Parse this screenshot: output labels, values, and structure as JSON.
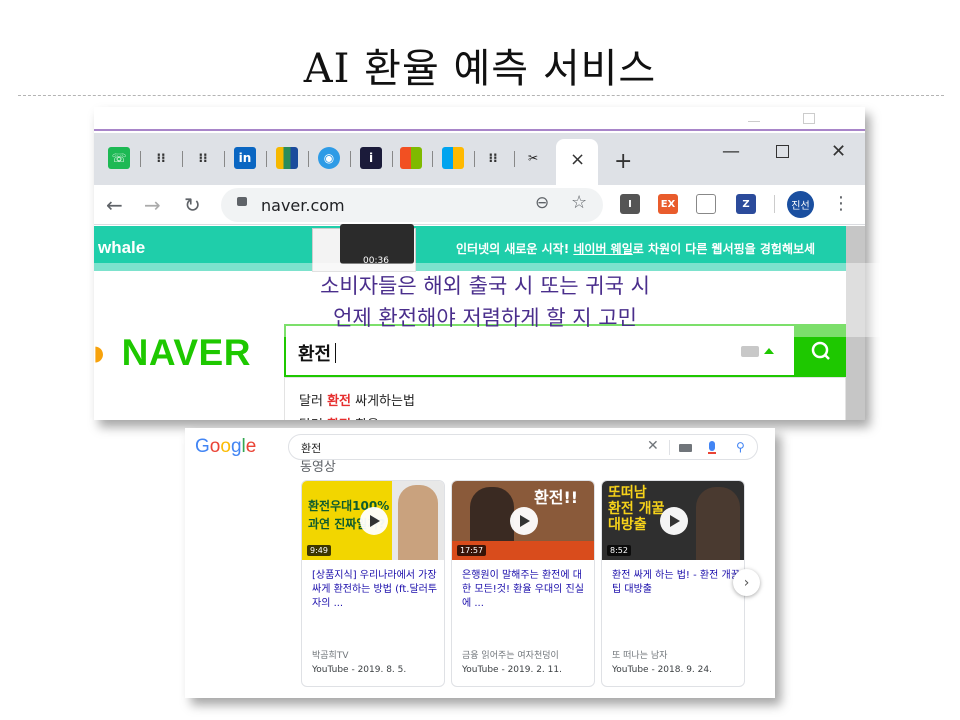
{
  "slide": {
    "title": "AI 환율 예측 서비스"
  },
  "browser": {
    "new_tab_label": "+",
    "close_tab_label": "×",
    "url": "naver.com",
    "extensions": [
      "I",
      "EX",
      "Z"
    ],
    "profile": "진선",
    "whale_banner": {
      "logo": "whale",
      "message_prefix": "인터넷의 새로운 시작! ",
      "message_link": "네이버 웨일",
      "message_suffix": "로 차원이 다른 웹서핑을 경험해보세",
      "video_time": "00:36"
    },
    "naver": {
      "logo": "NAVER",
      "query": "환전",
      "suggestions": [
        {
          "before": "달러 ",
          "hit": "환전",
          "after": " 싸게하는법"
        },
        {
          "before": "달러 ",
          "hit": "환전",
          "after": " 환율"
        }
      ]
    }
  },
  "overlay": {
    "line1": "소비자들은 해외 출국  시 또는 귀국 시",
    "line2": "언제 환전해야 저렴하게 할 지 고민"
  },
  "google": {
    "logo": "Google",
    "query": "환전",
    "section_clip": "동영상",
    "videos": [
      {
        "thumb_text": "환전우대100%\n과연 진짜일까?",
        "duration": "9:49",
        "title": "[상품지식] 우리나라에서 가장 싸게 환전하는 방법 (ft.달러투자의 ...",
        "channel": "박곰희TV",
        "meta": "YouTube - 2019. 8. 5."
      },
      {
        "thumb_text": "환전!!",
        "duration": "17:57",
        "title": "은행원이 말해주는 환전에 대한 모든!것! 환율 우대의 진실에 ...",
        "channel": "금융 읽어주는 여자천덩이",
        "meta": "YouTube - 2019. 2. 11."
      },
      {
        "thumb_text": "또떠남\n환전 개꿀\n대방출",
        "duration": "8:52",
        "title": "환전 싸게 하는 법! - 환전 개꿀팁 대방출",
        "channel": "또 떠나는 남자",
        "meta": "YouTube - 2018. 9. 24."
      }
    ],
    "next_label": "›"
  },
  "colors": {
    "naver_green": "#1ec800",
    "whale_teal": "#1fceaa",
    "overlay_purple": "#4a2e8c",
    "link_blue": "#1a0dab"
  }
}
